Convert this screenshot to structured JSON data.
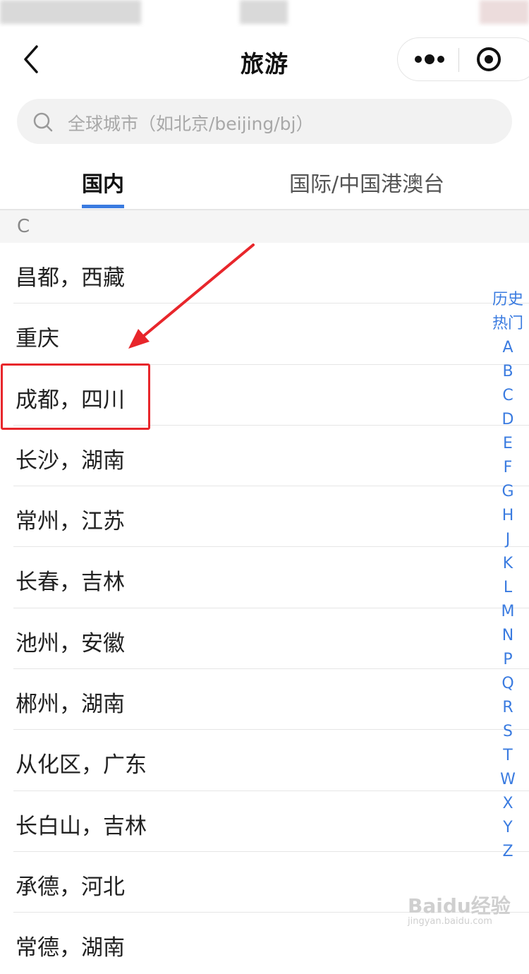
{
  "nav": {
    "title": "旅游"
  },
  "search": {
    "placeholder": "全球城市（如北京/beijing/bj）"
  },
  "tabs": [
    {
      "label": "国内",
      "active": true
    },
    {
      "label": "国际/中国港澳台",
      "active": false
    }
  ],
  "section": {
    "letter": "C"
  },
  "cities": [
    "昌都，西藏",
    "重庆",
    "成都，四川",
    "长沙，湖南",
    "常州，江苏",
    "长春，吉林",
    "池州，安徽",
    "郴州，湖南",
    "从化区，广东",
    "长白山，吉林",
    "承德，河北",
    "常德，湖南"
  ],
  "alpha_index": [
    "历史",
    "热门",
    "A",
    "B",
    "C",
    "D",
    "E",
    "F",
    "G",
    "H",
    "J",
    "K",
    "L",
    "M",
    "N",
    "P",
    "Q",
    "R",
    "S",
    "T",
    "W",
    "X",
    "Y",
    "Z"
  ],
  "watermark": {
    "brand": "Baidu经验",
    "domain": "jingyan.baidu.com"
  },
  "colors": {
    "accent": "#3a7be0",
    "annotation": "#e8262b"
  },
  "icons": {
    "back": "chevron-left-icon",
    "more": "more-dots-icon",
    "close": "target-circle-icon",
    "search": "search-icon"
  }
}
